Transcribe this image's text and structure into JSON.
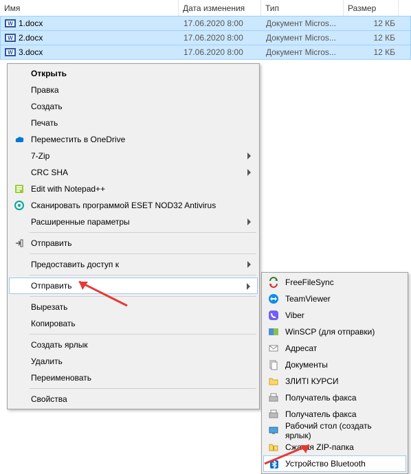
{
  "headers": {
    "name": "Имя",
    "date": "Дата изменения",
    "type": "Тип",
    "size": "Размер"
  },
  "files": [
    {
      "name": "1.docx",
      "date": "17.06.2020 8:00",
      "type": "Документ Micros...",
      "size": "12 КБ"
    },
    {
      "name": "2.docx",
      "date": "17.06.2020 8:00",
      "type": "Документ Micros...",
      "size": "12 КБ"
    },
    {
      "name": "3.docx",
      "date": "17.06.2020 8:00",
      "type": "Документ Micros...",
      "size": "12 КБ"
    }
  ],
  "menu": {
    "open": "Открыть",
    "edit": "Правка",
    "create": "Создать",
    "print": "Печать",
    "onedrive": "Переместить в OneDrive",
    "sevenzip": "7-Zip",
    "crcsha": "CRC SHA",
    "notepadpp": "Edit with Notepad++",
    "eset": "Сканировать программой ESET NOD32 Antivirus",
    "eset_ext": "Расширенные параметры",
    "share": "Отправить",
    "grant_access": "Предоставить доступ к",
    "send_to": "Отправить",
    "cut": "Вырезать",
    "copy": "Копировать",
    "create_shortcut": "Создать ярлык",
    "delete": "Удалить",
    "rename": "Переименовать",
    "properties": "Свойства"
  },
  "submenu": {
    "freefilesync": "FreeFileSync",
    "teamviewer": "TeamViewer",
    "viber": "Viber",
    "winscp": "WinSCP (для отправки)",
    "addressee": "Адресат",
    "documents": "Документы",
    "zliti": "ЗЛИТІ КУРСИ",
    "fax1": "Получатель факса",
    "fax2": "Получатель факса",
    "desktop": "Рабочий стол (создать ярлык)",
    "zip": "Сжатая ZIP-папка",
    "bluetooth": "Устройство Bluetooth"
  }
}
